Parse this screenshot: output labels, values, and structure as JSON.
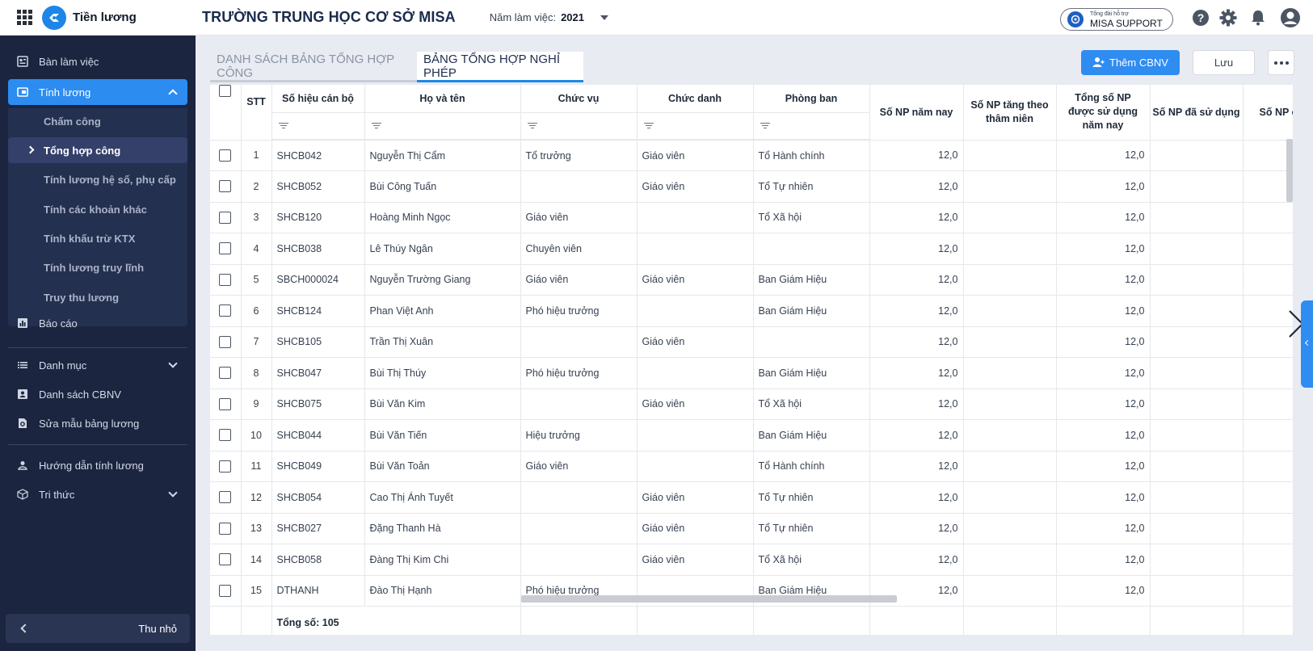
{
  "app": {
    "name": "Tiền lương"
  },
  "header": {
    "school": "TRƯỜNG TRUNG HỌC CƠ SỞ MISA",
    "year_label": "Năm làm việc:",
    "year_value": "2021",
    "support_small": "Tổng đài hỗ trợ",
    "support_big": "MISA SUPPORT"
  },
  "sidebar": {
    "items": [
      {
        "label": "Bàn làm việc",
        "icon": "dashboard-icon"
      },
      {
        "label": "Tính lương",
        "icon": "payroll-icon"
      },
      {
        "label": "Báo cáo",
        "icon": "report-icon"
      },
      {
        "label": "Danh mục",
        "icon": "list-icon"
      },
      {
        "label": "Danh sách CBNV",
        "icon": "contact-icon"
      },
      {
        "label": "Sửa mẫu bảng lương",
        "icon": "template-gear-icon"
      },
      {
        "label": "Hướng dẫn tính lương",
        "icon": "guide-icon"
      },
      {
        "label": "Tri thức",
        "icon": "cube-icon"
      }
    ],
    "submenu": [
      {
        "label": "Chấm công"
      },
      {
        "label": "Tổng hợp công"
      },
      {
        "label": "Tính lương hệ số, phụ cấp"
      },
      {
        "label": "Tính các khoản khác"
      },
      {
        "label": "Tính khấu trừ KTX"
      },
      {
        "label": "Tính lương truy lĩnh"
      },
      {
        "label": "Truy thu lương"
      }
    ],
    "collapse_label": "Thu nhỏ"
  },
  "tabs": [
    {
      "label": "DANH SÁCH BẢNG TỔNG HỢP CÔNG"
    },
    {
      "label": "BẢNG TỔNG HỢP NGHỈ PHÉP"
    }
  ],
  "toolbar": {
    "add_label": "Thêm CBNV",
    "save_label": "Lưu"
  },
  "table": {
    "columns": {
      "stt": "STT",
      "code": "Số hiệu cán bộ",
      "name": "Họ và tên",
      "position": "Chức vụ",
      "title": "Chức danh",
      "dept": "Phòng ban",
      "np_year": "Số NP năm nay",
      "np_seniority": "Số NP tăng theo thâm niên",
      "np_total": "Tổng số NP được sử dụng năm nay",
      "np_used": "Số NP đã sử dụng",
      "np_remaining": "Số NP c"
    },
    "rows": [
      {
        "stt": "1",
        "code": "SHCB042",
        "name": "Nguyễn Thị Cẩm",
        "position": "Tổ trưởng",
        "title": "Giáo viên",
        "dept": "Tổ Hành chính",
        "np_year": "12,0",
        "np_total": "12,0"
      },
      {
        "stt": "2",
        "code": "SHCB052",
        "name": "Bùi Công Tuấn",
        "position": "",
        "title": "Giáo viên",
        "dept": "Tổ Tự nhiên",
        "np_year": "12,0",
        "np_total": "12,0"
      },
      {
        "stt": "3",
        "code": "SHCB120",
        "name": "Hoàng Minh Ngọc",
        "position": "Giáo viên",
        "title": "",
        "dept": "Tổ Xã hội",
        "np_year": "12,0",
        "np_total": "12,0"
      },
      {
        "stt": "4",
        "code": "SHCB038",
        "name": "Lê Thúy Ngân",
        "position": "Chuyên viên",
        "title": "",
        "dept": "",
        "np_year": "12,0",
        "np_total": "12,0"
      },
      {
        "stt": "5",
        "code": "SBCH000024",
        "name": "Nguyễn Trường Giang",
        "position": "Giáo viên",
        "title": "Giáo viên",
        "dept": "Ban Giám Hiệu",
        "np_year": "12,0",
        "np_total": "12,0"
      },
      {
        "stt": "6",
        "code": "SHCB124",
        "name": "Phan Việt Anh",
        "position": "Phó hiệu trưởng",
        "title": "",
        "dept": "Ban Giám Hiệu",
        "np_year": "12,0",
        "np_total": "12,0"
      },
      {
        "stt": "7",
        "code": "SHCB105",
        "name": "Trần Thị Xuân",
        "position": "",
        "title": "Giáo viên",
        "dept": "",
        "np_year": "12,0",
        "np_total": "12,0"
      },
      {
        "stt": "8",
        "code": "SHCB047",
        "name": "Bùi Thị Thúy",
        "position": "Phó hiệu trưởng",
        "title": "",
        "dept": "Ban Giám Hiệu",
        "np_year": "12,0",
        "np_total": "12,0"
      },
      {
        "stt": "9",
        "code": "SHCB075",
        "name": "Bùi Văn Kim",
        "position": "",
        "title": "Giáo viên",
        "dept": "Tổ Xã hội",
        "np_year": "12,0",
        "np_total": "12,0"
      },
      {
        "stt": "10",
        "code": "SHCB044",
        "name": "Bùi Văn Tiến",
        "position": "Hiệu trưởng",
        "title": "",
        "dept": "Ban Giám Hiệu",
        "np_year": "12,0",
        "np_total": "12,0"
      },
      {
        "stt": "11",
        "code": "SHCB049",
        "name": "Bùi Văn Toản",
        "position": "Giáo viên",
        "title": "",
        "dept": "Tổ Hành chính",
        "np_year": "12,0",
        "np_total": "12,0"
      },
      {
        "stt": "12",
        "code": "SHCB054",
        "name": "Cao Thị Ánh Tuyết",
        "position": "",
        "title": "Giáo viên",
        "dept": "Tổ Tự nhiên",
        "np_year": "12,0",
        "np_total": "12,0"
      },
      {
        "stt": "13",
        "code": "SHCB027",
        "name": "Đặng Thanh Hà",
        "position": "",
        "title": "Giáo viên",
        "dept": "Tổ Tự nhiên",
        "np_year": "12,0",
        "np_total": "12,0"
      },
      {
        "stt": "14",
        "code": "SHCB058",
        "name": "Đàng Thị Kim Chi",
        "position": "",
        "title": "Giáo viên",
        "dept": "Tổ Xã hội",
        "np_year": "12,0",
        "np_total": "12,0"
      },
      {
        "stt": "15",
        "code": "DTHANH",
        "name": "Đào Thị Hạnh",
        "position": "Phó hiệu trưởng",
        "title": "",
        "dept": "Ban Giám Hiệu",
        "np_year": "12,0",
        "np_total": "12,0"
      }
    ],
    "total_label": "Tổng số: 105"
  },
  "colors": {
    "accent": "#2f8cf1",
    "sidebar": "#1b2540",
    "sidebar_active": "#2d8cf0"
  }
}
